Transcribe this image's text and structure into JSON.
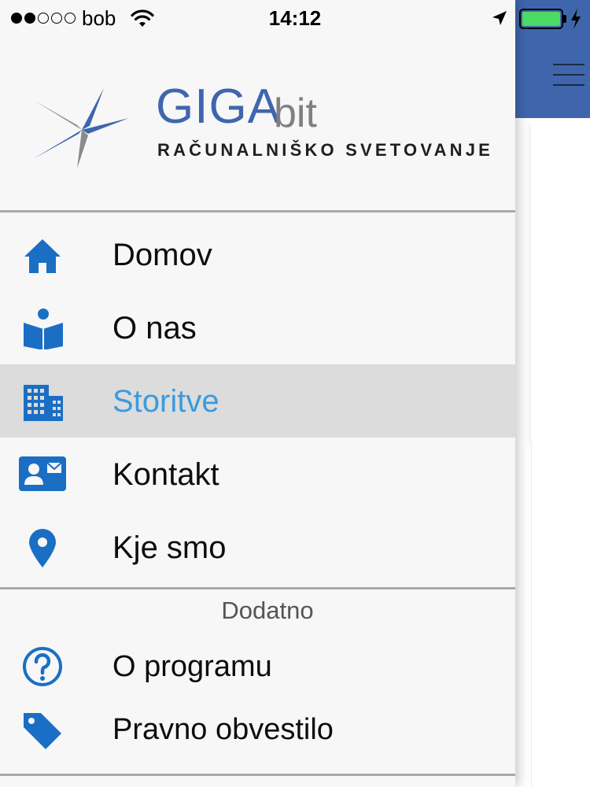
{
  "status_bar": {
    "carrier": "bob",
    "time": "14:12",
    "signal_bars_filled": 2,
    "signal_bars_total": 5,
    "battery_level": 1.0,
    "battery_color": "#4cd964"
  },
  "logo": {
    "brand_primary": "GIGA",
    "brand_secondary": "bit",
    "tagline": "RAČUNALNIŠKO SVETOVANJE"
  },
  "menu": {
    "items": [
      {
        "label": "Domov",
        "icon": "home-icon",
        "active": false
      },
      {
        "label": "O nas",
        "icon": "reader-book-icon",
        "active": false
      },
      {
        "label": "Storitve",
        "icon": "building-icon",
        "active": true
      },
      {
        "label": "Kontakt",
        "icon": "contact-card-icon",
        "active": false
      },
      {
        "label": "Kje smo",
        "icon": "location-pin-icon",
        "active": false
      }
    ],
    "section_title": "Dodatno",
    "extra_items": [
      {
        "label": "O programu",
        "icon": "question-circle-icon"
      },
      {
        "label": "Pravno obvestilo",
        "icon": "tag-icon"
      }
    ]
  },
  "colors": {
    "accent_blue": "#1a6fc4",
    "active_text": "#3a9be0",
    "brand_blue": "#3f66ad",
    "active_row_bg": "#dcdcdc"
  }
}
